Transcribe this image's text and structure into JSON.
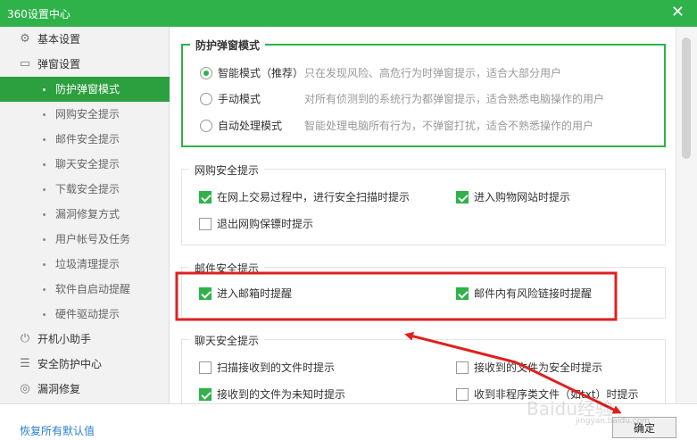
{
  "window": {
    "title": "360设置中心",
    "close_glyph": "✕"
  },
  "sidebar": {
    "top_items": [
      {
        "label": "基本设置",
        "icon": "gear-icon",
        "glyph": "⚙"
      },
      {
        "label": "弹窗设置",
        "icon": "window-icon",
        "glyph": "▭"
      },
      {
        "label": "开机小助手",
        "icon": "power-icon",
        "glyph": "⏻"
      },
      {
        "label": "安全防护中心",
        "icon": "shield-list-icon",
        "glyph": "☰"
      },
      {
        "label": "漏洞修复",
        "icon": "repair-icon",
        "glyph": "◎"
      }
    ],
    "sub_items": [
      "防护弹窗模式",
      "网购安全提示",
      "邮件安全提示",
      "聊天安全提示",
      "下载安全提示",
      "漏洞修复方式",
      "用户帐号及任务",
      "垃圾清理提示",
      "软件自启动提醒",
      "硬件驱动提示"
    ],
    "active_sub_index": 0
  },
  "sections": {
    "popup_mode": {
      "title": "防护弹窗模式",
      "options": [
        {
          "label": "智能模式（推荐）",
          "desc": "只在发现风险、高危行为时弹窗提示，适合大部分用户",
          "checked": true
        },
        {
          "label": "手动模式",
          "desc": "对所有侦测到的系统行为都弹窗提示，适合熟悉电脑操作的用户",
          "checked": false
        },
        {
          "label": "自动处理模式",
          "desc": "智能处理电脑所有行为，不弹窗打扰，适合不熟悉操作的用户",
          "checked": false
        }
      ]
    },
    "shopping": {
      "title": "网购安全提示",
      "options": [
        {
          "label": "在网上交易过程中，进行安全扫描时提示",
          "checked": true
        },
        {
          "label": "进入购物网站时提示",
          "checked": true
        },
        {
          "label": "退出网购保镖时提示",
          "checked": false
        }
      ]
    },
    "mail": {
      "title": "邮件安全提示",
      "options": [
        {
          "label": "进入邮箱时提醒",
          "checked": true
        },
        {
          "label": "邮件内有风险链接时提醒",
          "checked": true
        }
      ]
    },
    "chat": {
      "title": "聊天安全提示",
      "options": [
        {
          "label": "扫描接收到的文件时提示",
          "checked": false
        },
        {
          "label": "接收到的文件为安全时提示",
          "checked": false
        },
        {
          "label": "接收到的文件为未知时提示",
          "checked": true
        },
        {
          "label": "收到非程序类文件（如txt）时提示",
          "checked": false
        }
      ]
    }
  },
  "footer": {
    "restore_label": "恢复所有默认值",
    "ok_label": "确定"
  },
  "watermark": {
    "text": "Baidu经验",
    "sub": "jingyan.baidu.com"
  },
  "colors": {
    "brand_green": "#2fb24a",
    "active_green": "#2c9f3e",
    "annotation_red": "#e02020",
    "link_blue": "#2a7fd1"
  }
}
